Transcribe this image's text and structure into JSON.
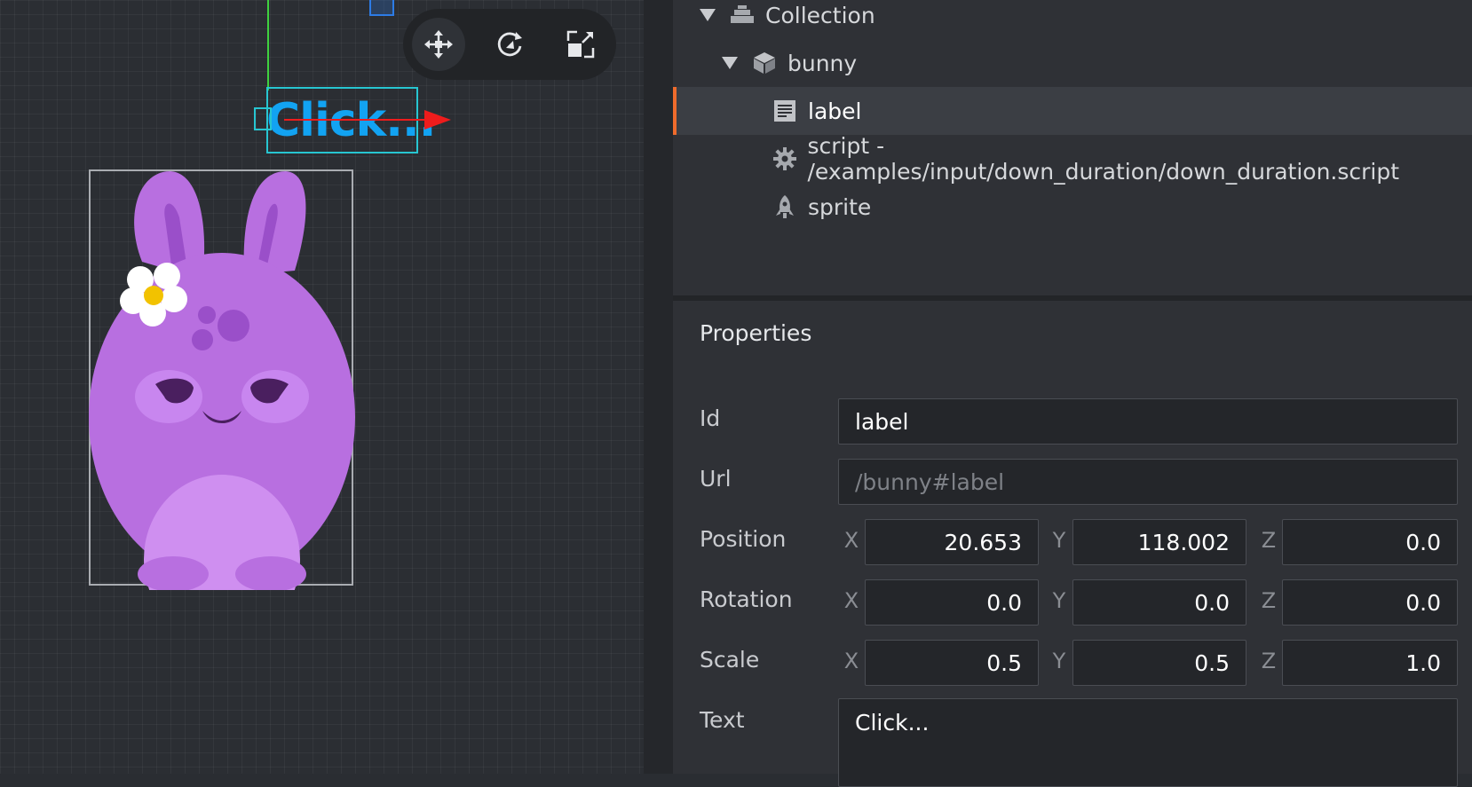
{
  "viewport": {
    "label_text": "Click...",
    "tools": [
      "move-tool",
      "rotate-tool",
      "scale-tool"
    ],
    "colors": {
      "x_axis": "#ee1c1c",
      "y_axis": "#3fd13f",
      "selection": "#27c6d1",
      "label_text": "#12a3f2",
      "bunny": "#b86fe0"
    }
  },
  "outline": {
    "items": [
      {
        "label": "Collection",
        "icon": "collection-icon",
        "expanded": true
      },
      {
        "label": "bunny",
        "icon": "game-object-icon",
        "expanded": true
      },
      {
        "label": "label",
        "icon": "label-icon",
        "selected": true
      },
      {
        "label": "script - /examples/input/down_duration/down_duration.script",
        "icon": "gear-icon"
      },
      {
        "label": "sprite",
        "icon": "sprite-icon"
      }
    ]
  },
  "properties": {
    "title": "Properties",
    "id": {
      "label": "Id",
      "value": "label"
    },
    "url": {
      "label": "Url",
      "placeholder": "/bunny#label"
    },
    "position": {
      "label": "Position",
      "x": "20.653",
      "y": "118.002",
      "z": "0.0"
    },
    "rotation": {
      "label": "Rotation",
      "x": "0.0",
      "y": "0.0",
      "z": "0.0"
    },
    "scale": {
      "label": "Scale",
      "x": "0.5",
      "y": "0.5",
      "z": "1.0"
    },
    "text": {
      "label": "Text",
      "value": "Click..."
    },
    "axis_labels": {
      "x": "X",
      "y": "Y",
      "z": "Z"
    }
  }
}
